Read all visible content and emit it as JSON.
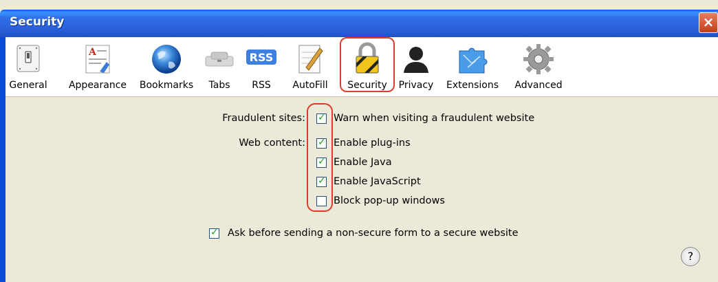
{
  "window": {
    "title": "Security",
    "close_glyph": "×"
  },
  "toolbar": {
    "items": [
      {
        "label": "General",
        "icon": "switch-icon"
      },
      {
        "label": "Appearance",
        "icon": "appearance-icon"
      },
      {
        "label": "Bookmarks",
        "icon": "globe-icon"
      },
      {
        "label": "Tabs",
        "icon": "tabs-icon"
      },
      {
        "label": "RSS",
        "icon": "rss-icon"
      },
      {
        "label": "AutoFill",
        "icon": "autofill-icon"
      },
      {
        "label": "Security",
        "icon": "lock-icon",
        "selected": true
      },
      {
        "label": "Privacy",
        "icon": "person-silhouette-icon"
      },
      {
        "label": "Extensions",
        "icon": "puzzle-circuit-icon"
      },
      {
        "label": "Advanced",
        "icon": "gear-icon"
      }
    ]
  },
  "security": {
    "fraudulent_label": "Fraudulent sites:",
    "warn_fraudulent": "Warn when visiting a fraudulent website",
    "web_content_label": "Web content:",
    "enable_plugins": "Enable plug-ins",
    "enable_java": "Enable Java",
    "enable_javascript": "Enable JavaScript",
    "block_popups": "Block pop-up windows",
    "ask_nonsecure": "Ask before sending a non-secure form to a secure website",
    "checked": {
      "warn_fraudulent": true,
      "enable_plugins": true,
      "enable_java": true,
      "enable_javascript": true,
      "block_popups": false,
      "ask_nonsecure": true
    }
  },
  "help": {
    "glyph": "?"
  }
}
